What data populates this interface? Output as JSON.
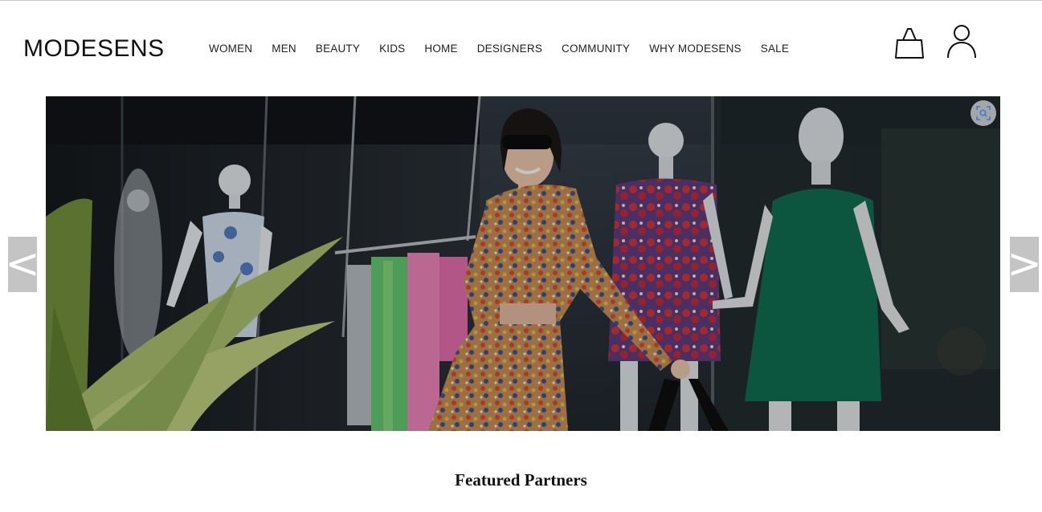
{
  "brand": {
    "logo_text": "MODESENS"
  },
  "nav": {
    "items": [
      {
        "label": "WOMEN"
      },
      {
        "label": "MEN"
      },
      {
        "label": "BEAUTY"
      },
      {
        "label": "KIDS"
      },
      {
        "label": "HOME"
      },
      {
        "label": "DESIGNERS"
      },
      {
        "label": "COMMUNITY"
      },
      {
        "label": "WHY MODESENS"
      },
      {
        "label": "SALE"
      }
    ]
  },
  "header_icons": {
    "bag": "shopping-bag-icon",
    "account": "user-icon"
  },
  "carousel": {
    "prev_label": "<",
    "next_label": ">",
    "zoom_icon": "image-search-icon"
  },
  "sections": {
    "featured_title": "Featured Partners"
  },
  "colors": {
    "text": "#111111",
    "arrow_bg": "#c4c4c4",
    "arrow_fg": "#ffffff",
    "zoom_icon": "#3a7bd5"
  }
}
